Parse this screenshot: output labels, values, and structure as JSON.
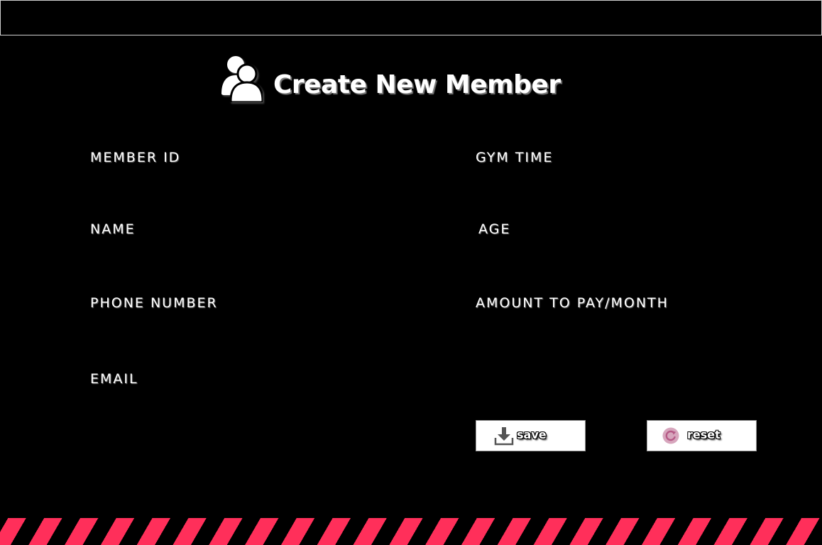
{
  "header": {
    "title": "Create New Member",
    "icon": "users-icon"
  },
  "form": {
    "left_fields": [
      {
        "label": "MEMBER ID"
      },
      {
        "label": "NAME"
      },
      {
        "label": "PHONE NUMBER"
      },
      {
        "label": "EMAIL"
      }
    ],
    "right_fields": [
      {
        "label": "GYM TIME"
      },
      {
        "label": "AGE"
      },
      {
        "label": "AMOUNT TO PAY/MONTH"
      }
    ]
  },
  "actions": {
    "save_label": "save",
    "save_icon": "download-icon",
    "reset_label": "reset",
    "reset_icon": "refresh-icon"
  },
  "colors": {
    "background": "#000000",
    "accent_stripe": "#ff2f5a",
    "text": "#ffffff",
    "button_background": "#ffffff"
  }
}
